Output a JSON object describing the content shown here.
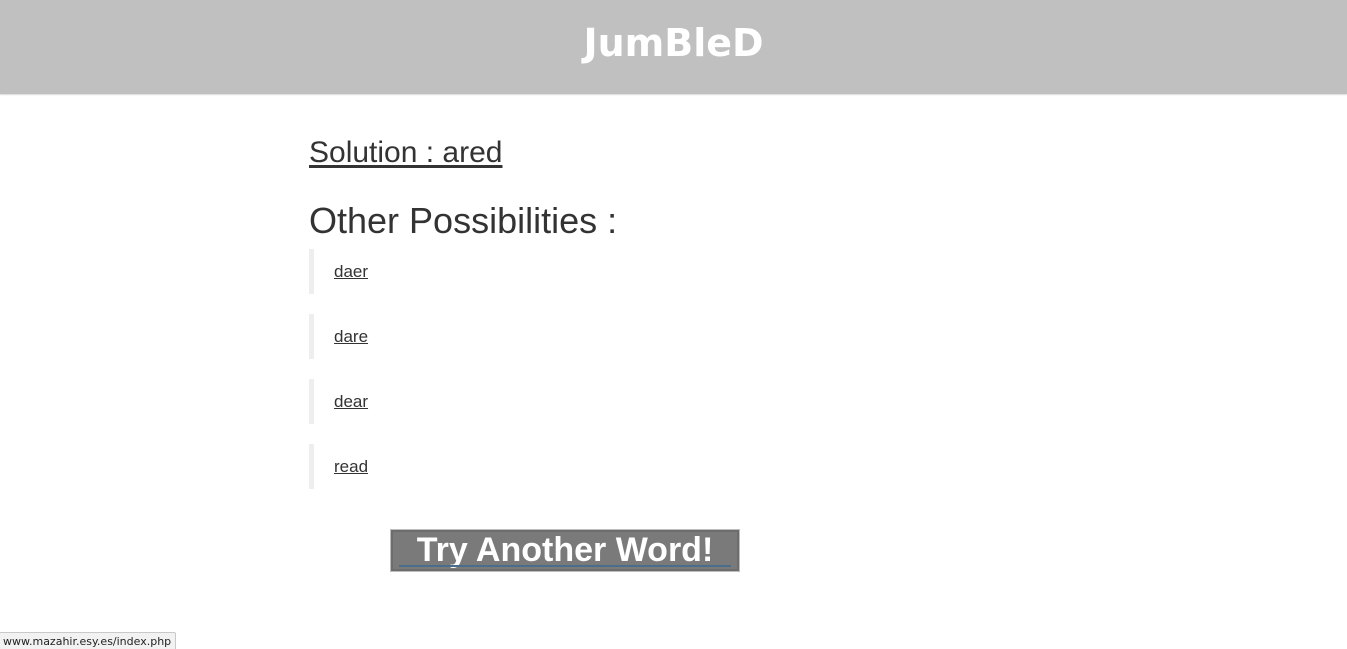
{
  "header": {
    "logo_text": "JumBleD"
  },
  "main": {
    "solution_text": "Solution : ared",
    "other_heading": "Other Possibilities :",
    "possibilities": [
      {
        "word": "daer"
      },
      {
        "word": "dare"
      },
      {
        "word": "dear"
      },
      {
        "word": "read"
      }
    ],
    "try_button_label": "Try Another Word!"
  },
  "status_bar": {
    "url": "www.mazahir.esy.es/index.php"
  },
  "colors": {
    "header_bg": "#c0c0c0",
    "button_bg": "#7a7a7a",
    "text": "#333333"
  }
}
